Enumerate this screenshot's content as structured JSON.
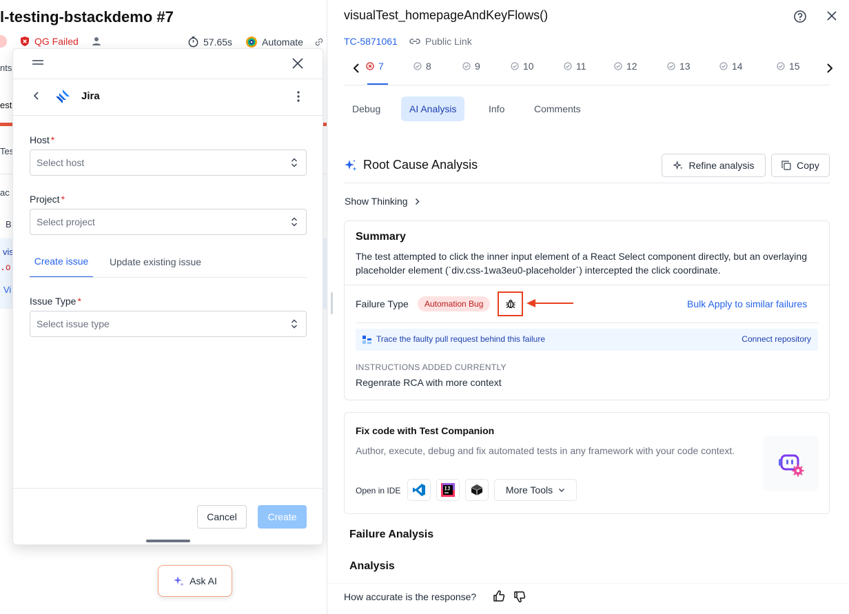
{
  "background": {
    "build_title": "l-testing-bstackdemo #7",
    "qg_status": "QG Failed",
    "duration": "57.65s",
    "automate_label": "Automate",
    "fragments": [
      "nts",
      "est",
      "Tes",
      "ac",
      "B",
      "vis",
      ".o",
      "Vi"
    ]
  },
  "jira_panel": {
    "title": "Jira",
    "host_label": "Host",
    "host_placeholder": "Select host",
    "project_label": "Project",
    "project_placeholder": "Select project",
    "tabs": [
      "Create issue",
      "Update existing issue"
    ],
    "issue_type_label": "Issue Type",
    "issue_type_placeholder": "Select issue type",
    "required_mark": "*",
    "cancel_label": "Cancel",
    "create_label": "Create"
  },
  "ask_ai": {
    "label": "Ask AI"
  },
  "detail": {
    "title": "visualTest_homepageAndKeyFlows()",
    "test_id": "TC-5871061",
    "public_link": "Public Link",
    "runs": [
      "7",
      "8",
      "9",
      "10",
      "11",
      "12",
      "13",
      "14",
      "15"
    ],
    "subtabs": [
      "Debug",
      "AI Analysis",
      "Info",
      "Comments"
    ],
    "rca_title": "Root Cause Analysis",
    "refine_label": "Refine analysis",
    "copy_label": "Copy",
    "show_thinking": "Show Thinking",
    "summary": {
      "title": "Summary",
      "text": "The test attempted to click the inner input element of a React Select component directly, but an overlaying placeholder element (`div.css-1wa3eu0-placeholder`) intercepted the click coordinate.",
      "failure_type_label": "Failure Type",
      "failure_type_badge": "Automation Bug",
      "bulk_apply": "Bulk Apply to similar failures",
      "trace_text": "Trace the faulty pull request behind this failure",
      "connect_repo": "Connect repository",
      "instructions_heading": "INSTRUCTIONS ADDED CURRENTLY",
      "instructions_text": "Regenrate RCA with more context"
    },
    "companion": {
      "title": "Fix code with Test Companion",
      "text": "Author, execute, debug and fix automated tests in any framework with your code context.",
      "open_in_ide": "Open in IDE",
      "more_tools": "More Tools"
    },
    "failure_analysis": "Failure Analysis",
    "analysis": "Analysis",
    "feedback_question": "How accurate is the response?"
  },
  "colors": {
    "accent": "#2563eb",
    "failed": "#dc2626",
    "highlight_box": "#e8411f",
    "active_tab_bg": "#dbeafe"
  }
}
